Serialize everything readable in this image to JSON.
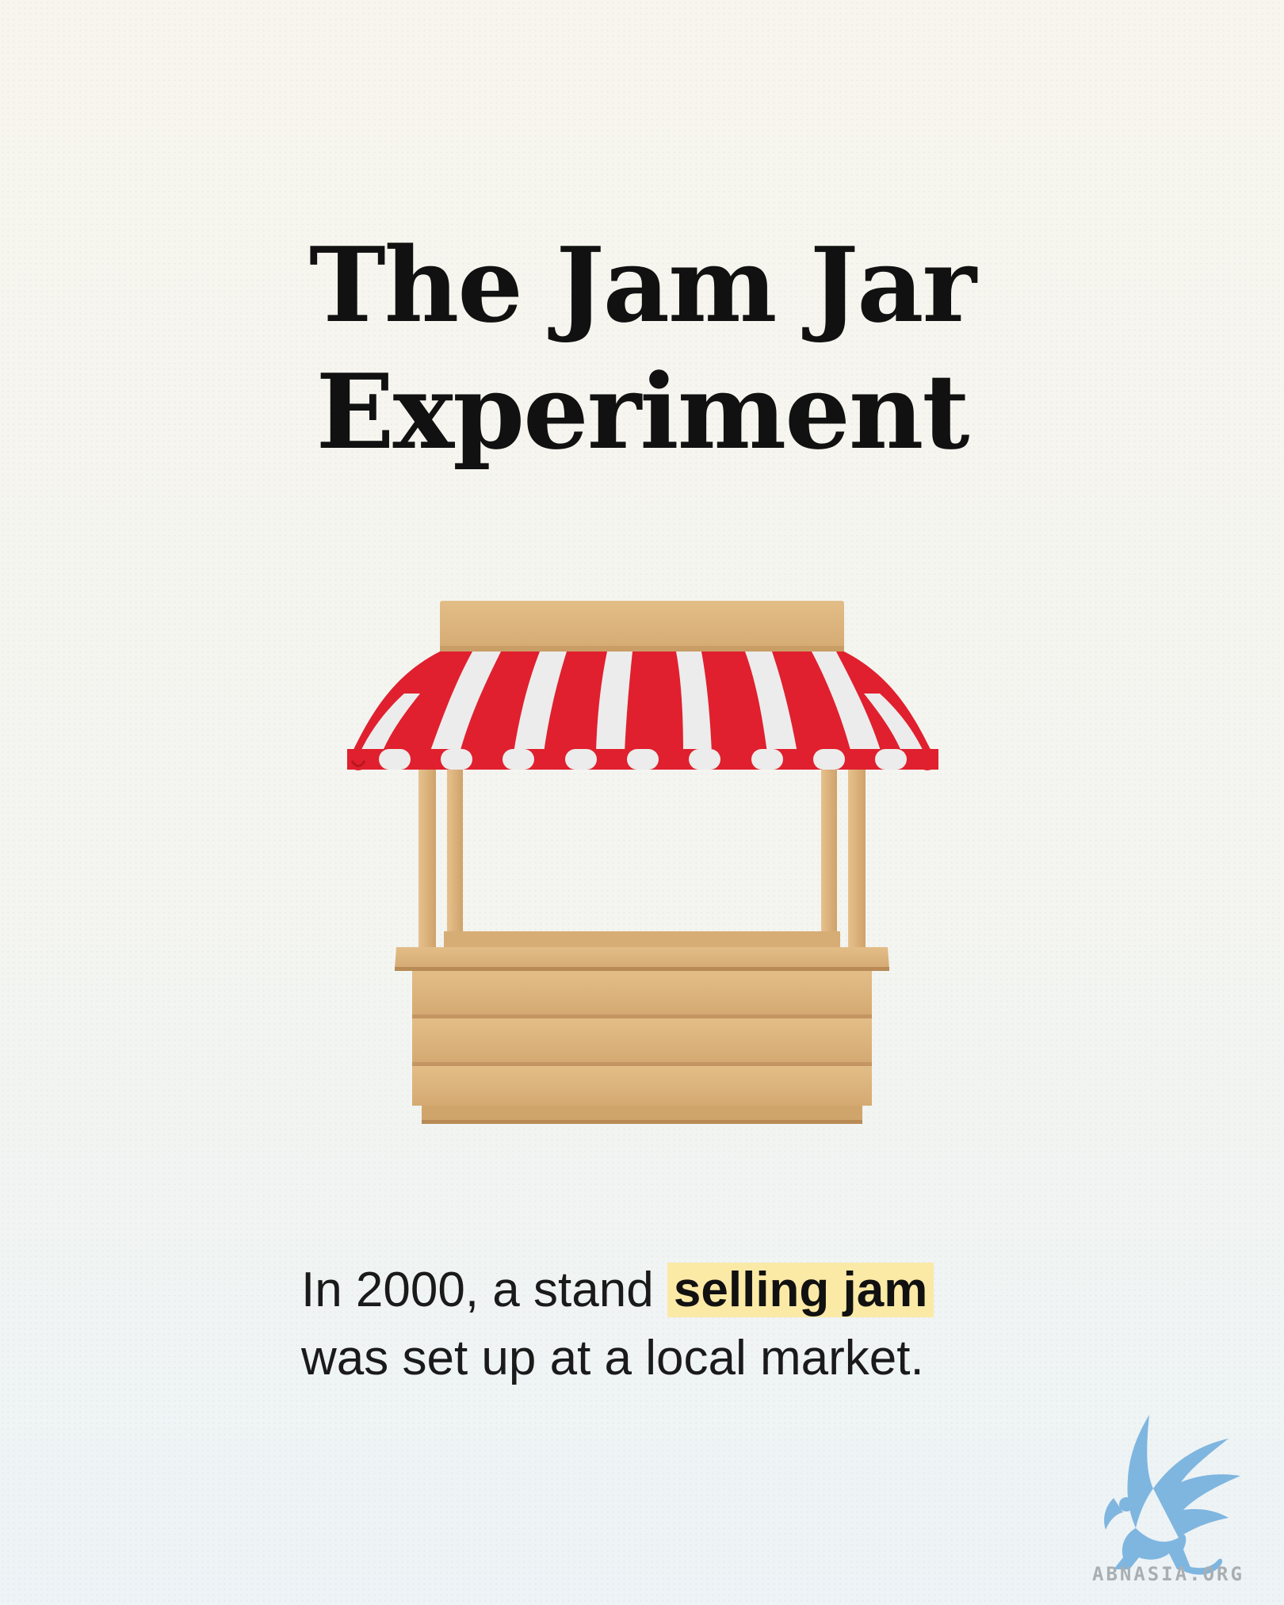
{
  "title": {
    "line1": "The Jam Jar",
    "line2": "Experiment"
  },
  "caption": {
    "before": "In 2000, a stand ",
    "highlight": "selling jam",
    "after": "was set up at a local market."
  },
  "illustration": {
    "icon": "market-stand-icon"
  },
  "logo": {
    "icon": "griffin-logo-icon",
    "text": "ABNASIA.ORG"
  },
  "colors": {
    "awning_red": "#e0202e",
    "awning_white": "#ececec",
    "wood": "#ddb57e",
    "highlight": "#fbe9a6",
    "logo_blue": "#7fb6e0"
  }
}
